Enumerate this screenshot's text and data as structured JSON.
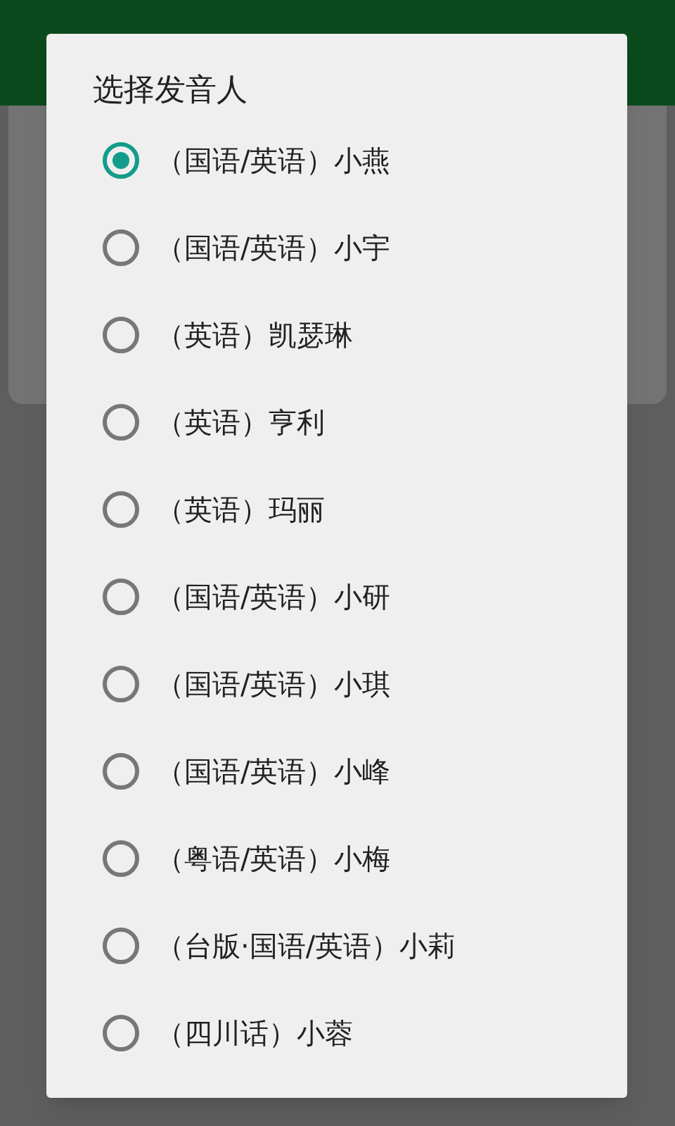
{
  "dialog": {
    "title": "选择发音人",
    "options": [
      {
        "label": "（国语/英语）小燕",
        "selected": true
      },
      {
        "label": "（国语/英语）小宇",
        "selected": false
      },
      {
        "label": "（英语）凯瑟琳",
        "selected": false
      },
      {
        "label": "（英语）亨利",
        "selected": false
      },
      {
        "label": "（英语）玛丽",
        "selected": false
      },
      {
        "label": "（国语/英语）小研",
        "selected": false
      },
      {
        "label": "（国语/英语）小琪",
        "selected": false
      },
      {
        "label": "（国语/英语）小峰",
        "selected": false
      },
      {
        "label": "（粤语/英语）小梅",
        "selected": false
      },
      {
        "label": "（台版·国语/英语）小莉",
        "selected": false
      },
      {
        "label": "（四川话）小蓉",
        "selected": false
      }
    ]
  }
}
